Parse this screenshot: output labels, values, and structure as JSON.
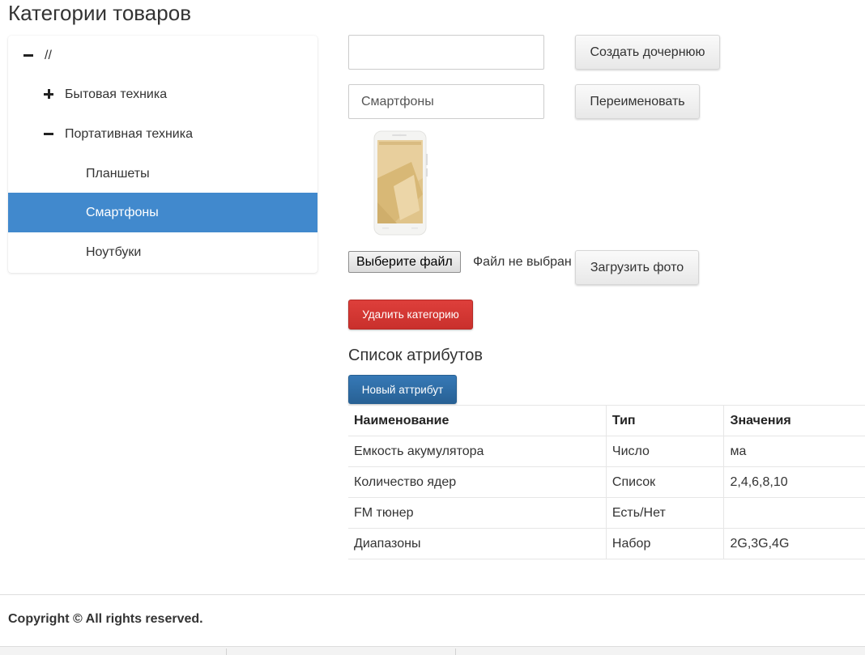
{
  "page": {
    "title": "Категории товаров"
  },
  "tree": {
    "items": [
      {
        "label": "//",
        "toggle": "minus"
      },
      {
        "label": "Бытовая техника",
        "toggle": "plus"
      },
      {
        "label": "Портативная техника",
        "toggle": "minus"
      },
      {
        "label": "Планшеты",
        "toggle": "none"
      },
      {
        "label": "Смартфоны",
        "toggle": "none",
        "active": true
      },
      {
        "label": "Ноутбуки",
        "toggle": "none"
      }
    ],
    "active_color": "#4189cd"
  },
  "form": {
    "child_name_value": "",
    "create_child_label": "Создать дочернюю",
    "rename_value": "Смартфоны",
    "rename_label": "Переименовать",
    "file_button_label": "Выберите файл",
    "file_status": "Файл не выбран",
    "upload_photo_label": "Загрузить фото",
    "delete_category_label": "Удалить категорию"
  },
  "attributes": {
    "title": "Список атрибутов",
    "new_attribute_label": "Новый аттрибут",
    "columns": [
      "Наименование",
      "Тип",
      "Значения"
    ],
    "rows": [
      [
        "Емкость акумулятора",
        "Число",
        "ма"
      ],
      [
        "Количество ядер",
        "Список",
        "2,4,6,8,10"
      ],
      [
        "FM тюнер",
        "Есть/Нет",
        ""
      ],
      [
        "Диапазоны",
        "Набор",
        "2G,3G,4G"
      ]
    ]
  },
  "footer": {
    "copyright": "Copyright © All rights reserved."
  },
  "colors": {
    "danger": "#d9534f",
    "primary": "#2e6da4",
    "phone_screen": "#e0c48a"
  },
  "icons": {
    "collapse": "minus-icon",
    "expand": "plus-icon"
  }
}
